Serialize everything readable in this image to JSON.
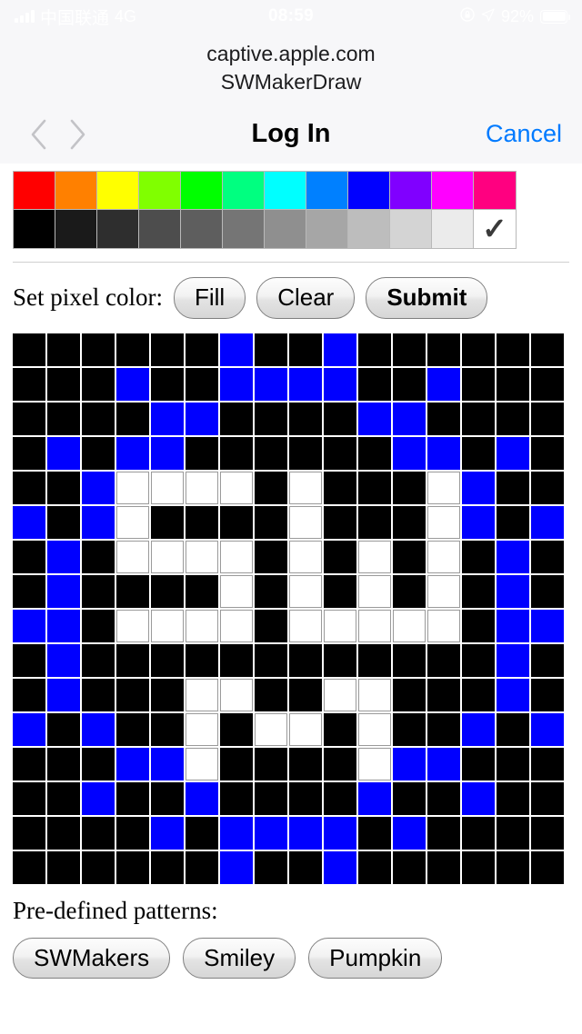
{
  "status_bar": {
    "carrier": "中国联通",
    "network": "4G",
    "time": "08:59",
    "lock_icon": "lock-icon",
    "location_icon": "location-arrow-icon",
    "battery_percent": "92%",
    "signal_icon": "signal-bars-icon",
    "battery_icon": "battery-icon"
  },
  "browser": {
    "host": "captive.apple.com",
    "page_title": "SWMakerDraw",
    "back_icon": "chevron-left-icon",
    "forward_icon": "chevron-right-icon",
    "nav_title": "Log In",
    "cancel_label": "Cancel"
  },
  "palette": {
    "selected_index": 23,
    "selected_color": "#ffffff",
    "check_glyph": "✓",
    "rows": [
      [
        "#ff0000",
        "#ff8000",
        "#ffff00",
        "#80ff00",
        "#00ff00",
        "#00ff80",
        "#00ffff",
        "#0080ff",
        "#0000ff",
        "#8000ff",
        "#ff00ff",
        "#ff0080"
      ],
      [
        "#000000",
        "#1a1a1a",
        "#2e2e2e",
        "#4d4d4d",
        "#5e5e5e",
        "#757575",
        "#8f8f8f",
        "#a6a6a6",
        "#bdbdbd",
        "#d4d4d4",
        "#ebebeb",
        "#ffffff"
      ]
    ]
  },
  "controls": {
    "label": "Set pixel color:",
    "fill_label": "Fill",
    "clear_label": "Clear",
    "submit_label": "Submit"
  },
  "patterns": {
    "label": "Pre-defined patterns:",
    "buttons": [
      "SWMakers",
      "Smiley",
      "Pumpkin"
    ]
  },
  "grid": {
    "columns": 16,
    "rows": 16,
    "colors": {
      "k": "#000000",
      "b": "#0000ff",
      "w": "#ffffff"
    },
    "cells": [
      [
        "k",
        "k",
        "k",
        "k",
        "k",
        "k",
        "b",
        "k",
        "k",
        "b",
        "k",
        "k",
        "k",
        "k",
        "k",
        "k"
      ],
      [
        "k",
        "k",
        "k",
        "b",
        "k",
        "k",
        "b",
        "b",
        "b",
        "b",
        "k",
        "k",
        "b",
        "k",
        "k",
        "k"
      ],
      [
        "k",
        "k",
        "k",
        "k",
        "b",
        "b",
        "k",
        "k",
        "k",
        "k",
        "b",
        "b",
        "k",
        "k",
        "k",
        "k"
      ],
      [
        "k",
        "b",
        "k",
        "b",
        "b",
        "k",
        "k",
        "k",
        "k",
        "k",
        "k",
        "b",
        "b",
        "k",
        "b",
        "k"
      ],
      [
        "k",
        "k",
        "b",
        "w",
        "w",
        "w",
        "w",
        "k",
        "w",
        "k",
        "k",
        "k",
        "w",
        "b",
        "k",
        "k"
      ],
      [
        "b",
        "k",
        "b",
        "w",
        "k",
        "k",
        "k",
        "k",
        "w",
        "k",
        "k",
        "k",
        "w",
        "b",
        "k",
        "b"
      ],
      [
        "k",
        "b",
        "k",
        "w",
        "w",
        "w",
        "w",
        "k",
        "w",
        "k",
        "w",
        "k",
        "w",
        "k",
        "b",
        "k"
      ],
      [
        "k",
        "b",
        "k",
        "k",
        "k",
        "k",
        "w",
        "k",
        "w",
        "k",
        "w",
        "k",
        "w",
        "k",
        "b",
        "k"
      ],
      [
        "b",
        "b",
        "k",
        "w",
        "w",
        "w",
        "w",
        "k",
        "w",
        "w",
        "w",
        "w",
        "w",
        "k",
        "b",
        "b"
      ],
      [
        "k",
        "b",
        "k",
        "k",
        "k",
        "k",
        "k",
        "k",
        "k",
        "k",
        "k",
        "k",
        "k",
        "k",
        "b",
        "k"
      ],
      [
        "k",
        "b",
        "k",
        "k",
        "k",
        "w",
        "w",
        "k",
        "k",
        "w",
        "w",
        "k",
        "k",
        "k",
        "b",
        "k"
      ],
      [
        "b",
        "k",
        "b",
        "k",
        "k",
        "w",
        "k",
        "w",
        "w",
        "k",
        "w",
        "k",
        "k",
        "b",
        "k",
        "b"
      ],
      [
        "k",
        "k",
        "k",
        "b",
        "b",
        "w",
        "k",
        "k",
        "k",
        "k",
        "w",
        "b",
        "b",
        "k",
        "k",
        "k"
      ],
      [
        "k",
        "k",
        "b",
        "k",
        "k",
        "b",
        "k",
        "k",
        "k",
        "k",
        "b",
        "k",
        "k",
        "b",
        "k",
        "k"
      ],
      [
        "k",
        "k",
        "k",
        "k",
        "b",
        "k",
        "b",
        "b",
        "b",
        "b",
        "k",
        "b",
        "k",
        "k",
        "k",
        "k"
      ],
      [
        "k",
        "k",
        "k",
        "k",
        "k",
        "k",
        "b",
        "k",
        "k",
        "b",
        "k",
        "k",
        "k",
        "k",
        "k",
        "k"
      ]
    ]
  }
}
